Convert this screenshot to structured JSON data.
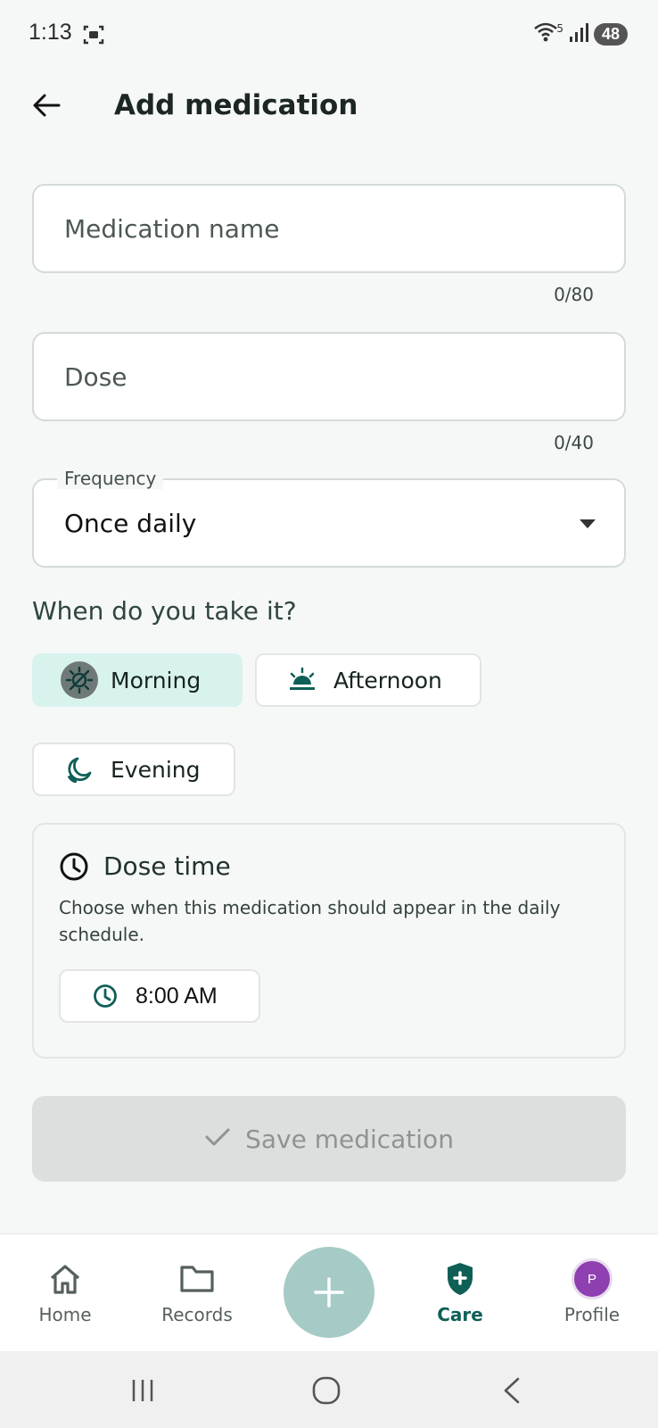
{
  "status_bar": {
    "time": "1:13",
    "battery": "48",
    "network_badge": "5"
  },
  "header": {
    "title": "Add medication"
  },
  "form": {
    "name_placeholder": "Medication name",
    "name_counter": "0/80",
    "dose_placeholder": "Dose",
    "dose_counter": "0/40",
    "frequency_label": "Frequency",
    "frequency_value": "Once daily"
  },
  "when": {
    "question": "When do you take it?",
    "options": [
      {
        "label": "Morning",
        "icon": "morning-sun-icon",
        "selected": true
      },
      {
        "label": "Afternoon",
        "icon": "sunset-icon",
        "selected": false
      },
      {
        "label": "Evening",
        "icon": "moon-icon",
        "selected": false
      }
    ]
  },
  "dose_time": {
    "title": "Dose time",
    "description": "Choose when this medication should appear in the daily schedule.",
    "time": "8:00 AM"
  },
  "save": {
    "label": "Save medication",
    "enabled": false
  },
  "bottom_nav": {
    "items": [
      {
        "label": "Home",
        "icon": "home-icon"
      },
      {
        "label": "Records",
        "icon": "folder-icon"
      },
      {
        "label": "Care",
        "icon": "shield-plus-icon",
        "active": true
      },
      {
        "label": "Profile",
        "icon": "avatar"
      }
    ],
    "avatar_initial": "P"
  },
  "colors": {
    "accent": "#0f5f57",
    "chip_selected": "#d8f2ee",
    "fab": "#a6cbc7",
    "avatar": "#8e3fb0"
  }
}
